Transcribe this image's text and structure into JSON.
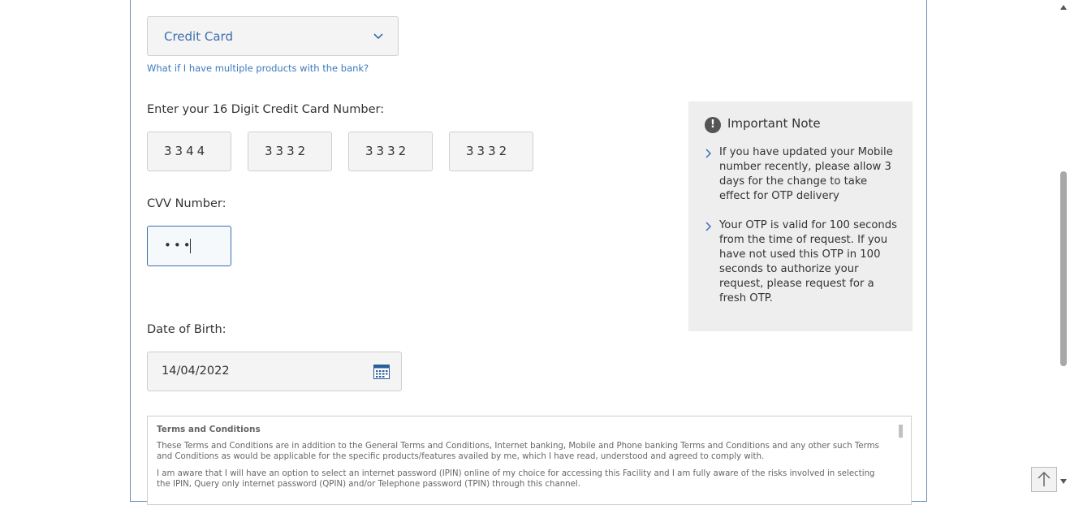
{
  "product": {
    "selected": "Credit Card",
    "help_link": "What if I have multiple products with the bank?"
  },
  "card": {
    "label": "Enter your 16 Digit Credit Card Number:",
    "segments": [
      "3344",
      "3332",
      "3332",
      "3332"
    ]
  },
  "cvv": {
    "label": "CVV Number:",
    "masked": "•••"
  },
  "dob": {
    "label": "Date of Birth:",
    "value": "14/04/2022"
  },
  "note": {
    "title": "Important Note",
    "items": [
      "If you have updated your Mobile number recently, please allow 3 days for the change to take effect for OTP delivery",
      "Your OTP is valid for 100 seconds from the time of request. If you have not used this OTP in 100 seconds to authorize your request, please request for a fresh OTP."
    ]
  },
  "terms": {
    "title": "Terms and Conditions",
    "paragraphs": [
      "These Terms and Conditions are in addition to the General Terms and Conditions, Internet banking, Mobile and Phone banking Terms and Conditions and any other such Terms and Conditions as would be applicable for the specific products/features availed by me, which I have read, understood and agreed to comply with.",
      "I am aware that I will have an option to select an internet password (IPIN) online of my choice for accessing this Facility and I am fully aware of the risks involved in selecting the IPIN, Query only internet password (QPIN) and/or Telephone password (TPIN) through this channel."
    ]
  },
  "colors": {
    "accent": "#3b6fb0",
    "link": "#3b79bd",
    "note_bg": "#eeeeee"
  },
  "icons": {
    "dropdown": "chevron-down-icon",
    "calendar": "calendar-icon",
    "note": "exclamation-icon",
    "bullet": "chevron-right-icon",
    "scroll_top": "arrow-up-icon"
  }
}
